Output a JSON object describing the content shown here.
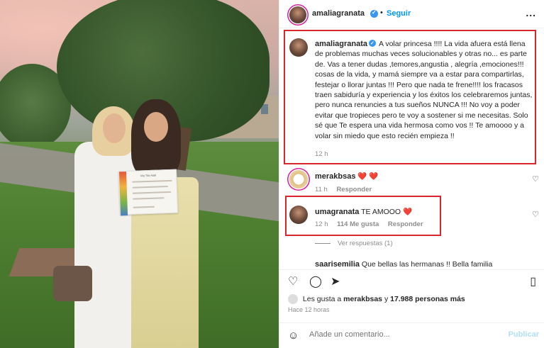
{
  "header": {
    "username": "amaliagranata",
    "separator": "•",
    "follow_label": "Seguir",
    "more_label": "..."
  },
  "caption": {
    "username": "amaliagranata",
    "text": "A volar princesa !!!! La vida afuera está llena de problemas muchas veces solucionables y otras no... es parte de. Vas a tener dudas ,temores,angustia , alegría ,emociones!!! cosas de la vida, y mamá siempre va a estar para compartirlas, festejar o llorar juntas !!! Pero que nada te frene!!!! los fracasos traen sabiduría y experiencia y los éxitos los celebraremos juntas, pero nunca renuncies a tus sueños NUNCA !!! No voy a poder evitar que tropieces pero te voy a sostener si me necesitas. Solo sé que Te espera una vida hermosa como vos !! Te amoooo y a volar sin miedo que esto recién empieza !!",
    "time": "12 h"
  },
  "comments": [
    {
      "username": "merakbsas",
      "text": "",
      "hearts": "❤️ ❤️",
      "time": "11 h",
      "reply_label": "Responder"
    },
    {
      "username": "umagranata",
      "text": "TE AMOOO",
      "hearts": "❤️",
      "time": "12 h",
      "likes": "114 Me gusta",
      "reply_label": "Responder"
    },
    {
      "username": "saarisemilia",
      "text": "Que bellas las hermanas !! Bella familia"
    }
  ],
  "view_replies": "Ver respuestas (1)",
  "likes": {
    "prefix": "Les gusta a",
    "first_user": "merakbsas",
    "connector": "y",
    "count": "17.988 personas más"
  },
  "ago": "Hace 12 horas",
  "add_comment": {
    "placeholder": "Añade un comentario...",
    "publish_label": "Publicar"
  },
  "photo": {
    "diploma_title": "Ma Tito Aalé"
  },
  "colors": {
    "accent": "#0095f6",
    "highlight_border": "#d9262c",
    "heart": "#ed1c24"
  }
}
